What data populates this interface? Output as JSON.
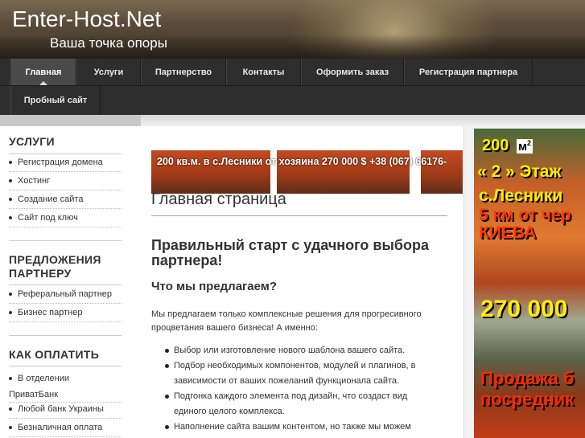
{
  "header": {
    "title": "Enter-Host.Net",
    "tagline": "Ваша точка опоры"
  },
  "nav": {
    "items": [
      {
        "label": "Главная"
      },
      {
        "label": "Услуги"
      },
      {
        "label": "Партнерство"
      },
      {
        "label": "Контакты"
      },
      {
        "label": "Оформить заказ"
      },
      {
        "label": "Регистрация партнера"
      },
      {
        "label": "Пробный сайт"
      }
    ]
  },
  "sidebar": {
    "sections": [
      {
        "heading": "УСЛУГИ",
        "links": [
          "Регистрация домена",
          "Хостинг",
          "Создание сайта",
          "Сайт под ключ"
        ]
      },
      {
        "heading_line1": "ПРЕДЛОЖЕНИЯ",
        "heading_line2": "ПАРТНЕРУ",
        "links": [
          "Реферальный партнер",
          "Бизнес партнер"
        ]
      },
      {
        "heading": "КАК ОПЛАТИТЬ",
        "links": [
          "В отделении",
          "ПриватБанк",
          "Любой банк Украины",
          "Безналичная оплата"
        ]
      }
    ]
  },
  "banner": {
    "text": "200 кв.м. в с.Лесники от хозяина 270 000 $ +38 (067) 66176-"
  },
  "main": {
    "page_title": "Главная страница",
    "headline": "Правильный старт с удачного выбора партнера!",
    "subheading": "Что мы предлагаем?",
    "intro": "Мы предлагаем только комплексные решения для прогресивного процветания вашего бизнеса! А именно:",
    "list": [
      "Выбор или изготовление нового шаблона вашего сайта.",
      "Подбор необходимых компонентов, модулей и плагинов, в зависимости от ваших пожеланий функционала сайта.",
      "Подгонка каждого элемента под дизайн, что создаст вид единого целого комплекса.",
      "Наполнение сайта вашим контентом, но также мы можем"
    ]
  },
  "ad": {
    "area": "200",
    "area_unit": "м",
    "area_sup": "2",
    "floors": "« 2 » Этаж",
    "village": "с.Лесники",
    "distance": "5 км от чер",
    "city": "КИЕВА",
    "price": "270 000",
    "sale_line1": "Продажа б",
    "sale_line2": "посредник"
  },
  "colors": {
    "header_bg": "#5a4c3a",
    "nav_bg": "#2e2e2e",
    "nav_active": "#4a4a4a",
    "banner_red": "#b8421e"
  }
}
